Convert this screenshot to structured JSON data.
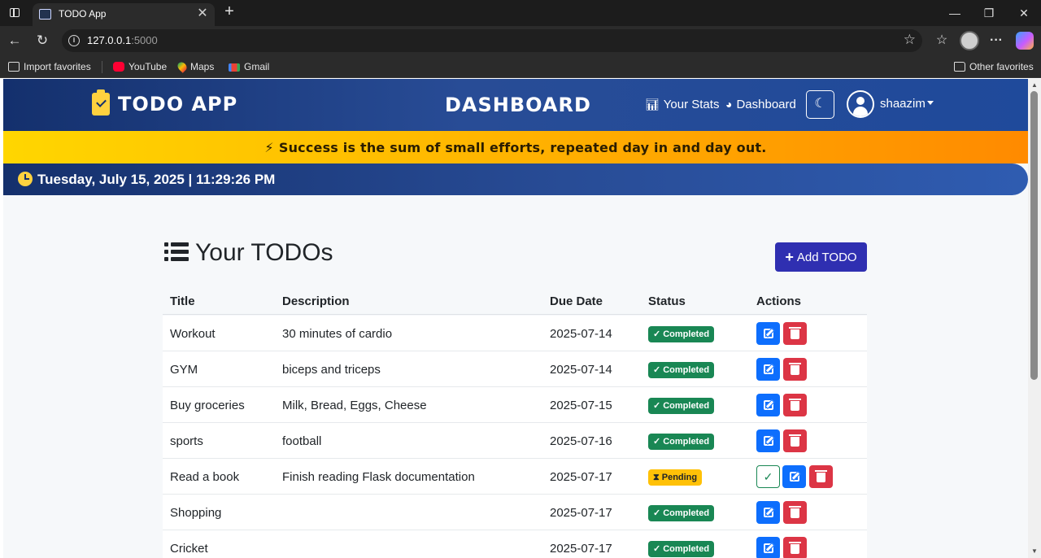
{
  "browser": {
    "tab_title": "TODO App",
    "url_host": "127.0.0.1",
    "url_port": ":5000",
    "bookmarks": {
      "import": "Import favorites",
      "youtube": "YouTube",
      "maps": "Maps",
      "gmail": "Gmail",
      "other": "Other favorites"
    }
  },
  "header": {
    "brand": "TODO APP",
    "center_title": "DASHBOARD",
    "links": {
      "stats": "Your Stats",
      "dashboard": "Dashboard"
    },
    "username": "shaazim"
  },
  "quote": "Success is the sum of small efforts, repeated day in and day out.",
  "datetime": "Tuesday, July 15, 2025 | 11:29:26 PM",
  "main": {
    "heading": "Your TODOs",
    "add_button": "Add TODO",
    "columns": {
      "title": "Title",
      "description": "Description",
      "due_date": "Due Date",
      "status": "Status",
      "actions": "Actions"
    },
    "todos": [
      {
        "title": "Workout",
        "description": "30 minutes of cardio",
        "due": "2025-07-14",
        "status": "Completed"
      },
      {
        "title": "GYM",
        "description": "biceps and triceps",
        "due": "2025-07-14",
        "status": "Completed"
      },
      {
        "title": "Buy groceries",
        "description": "Milk, Bread, Eggs, Cheese",
        "due": "2025-07-15",
        "status": "Completed"
      },
      {
        "title": "sports",
        "description": "football",
        "due": "2025-07-16",
        "status": "Completed"
      },
      {
        "title": "Read a book",
        "description": "Finish reading Flask documentation",
        "due": "2025-07-17",
        "status": "Pending"
      },
      {
        "title": "Shopping",
        "description": "",
        "due": "2025-07-17",
        "status": "Completed"
      },
      {
        "title": "Cricket",
        "description": "",
        "due": "2025-07-17",
        "status": "Completed"
      }
    ]
  },
  "colors": {
    "header_bg": "#284c96",
    "quote_start": "#ffd600",
    "quote_end": "#ff8a00",
    "add_button": "#2f2fb1",
    "completed": "#198754",
    "pending": "#ffc107",
    "edit": "#0d6efd",
    "delete": "#dc3545"
  }
}
